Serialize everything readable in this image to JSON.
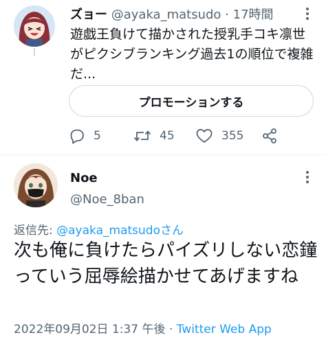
{
  "tweet1": {
    "display_name": "ズョー",
    "handle": "@ayaka_matsudo",
    "separator": "·",
    "time": "17時間",
    "text": "遊戯王負けて描かされた授乳手コキ凛世がピクシブランキング過去1の順位で複雑だ...",
    "promote_label": "プロモーションする",
    "actions": {
      "reply_icon": "reply-icon",
      "reply_count": "5",
      "retweet_icon": "retweet-icon",
      "retweet_count": "45",
      "like_icon": "heart-icon",
      "like_count": "355",
      "share_icon": "share-icon"
    }
  },
  "tweet2": {
    "display_name": "Noe",
    "handle": "@Noe_8ban",
    "reply_prefix": "返信先: ",
    "reply_target": "@ayaka_matsudoさん",
    "text": "次も俺に負けたらパイズリしない恋鐘っていう屈辱絵描かせてあげますね",
    "timestamp": "2022年09月02日 1:37 午後",
    "footer_separator": " · ",
    "client": "Twitter Web App"
  },
  "more_icon": "more-vertical-icon",
  "colors": {
    "text": "#0f1419",
    "secondary": "#536471",
    "link": "#1d9bf0",
    "border": "#cfd9de"
  }
}
